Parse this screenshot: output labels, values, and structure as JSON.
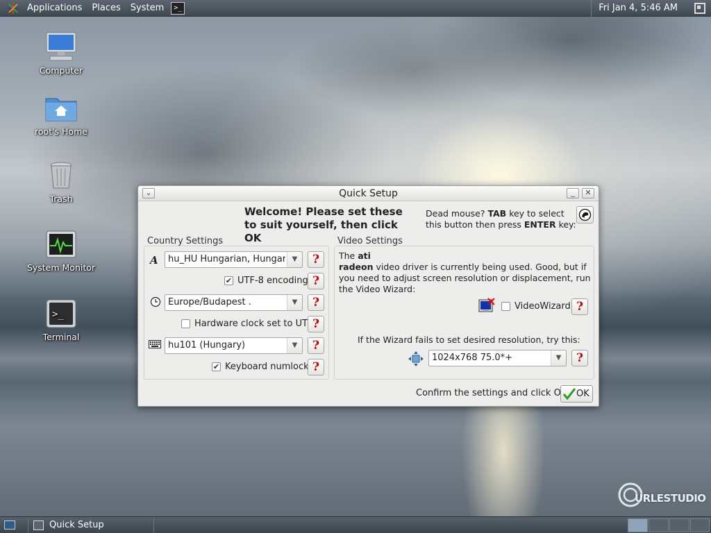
{
  "top_panel": {
    "menus": [
      "Applications",
      "Places",
      "System"
    ],
    "clock": "Fri Jan  4,  5:46 AM",
    "terminal_glyph": ">_"
  },
  "desktop": {
    "icons": [
      {
        "label": "Computer"
      },
      {
        "label": "root's Home"
      },
      {
        "label": "Trash"
      },
      {
        "label": "System Monitor"
      },
      {
        "label": "Terminal",
        "glyph": ">_"
      }
    ]
  },
  "dialog": {
    "title": "Quick Setup",
    "minimize_glyph": "_",
    "close_glyph": "✕",
    "menu_glyph": "⌄",
    "welcome": "Welcome! Please set these to suit yourself, then click OK",
    "dead_mouse": {
      "part1": "Dead mouse? ",
      "key1": "TAB",
      "part2": " key to select this button then press ",
      "key2": "ENTER",
      "part3": " key:"
    },
    "country": {
      "title": "Country Settings",
      "language_value": "hu_HU       Hungarian, Hungary",
      "utf8_label": "UTF-8 encoding",
      "utf8_checked": true,
      "timezone_value": "Europe/Budapest     .",
      "hwclock_label": "Hardware clock set to UTC",
      "hwclock_checked": false,
      "keyboard_value": "hu101        (Hungary)",
      "numlock_label": "Keyboard numlock",
      "numlock_checked": true
    },
    "video": {
      "title": "Video Settings",
      "text_the": "The ",
      "driver1": "ati",
      "driver2": "radeon",
      "text_rest": " video driver is currently being used. Good, but if you need to adjust screen resolution or displacement, run the Video Wizard:",
      "wizard_label": "VideoWizard",
      "wizard_checked": false,
      "fallback_text": "If the Wizard fails to set desired resolution, try this:",
      "resolution_value": "1024x768   75.0*+"
    },
    "confirm_text": "Confirm the settings and click OK:",
    "ok_label": "OK",
    "help_glyph": "?",
    "combo_arrow": "▼",
    "check_glyph": "✔"
  },
  "taskbar": {
    "task_label": "Quick Setup"
  },
  "branding": "URLESTUDIO",
  "colors": {
    "help_red": "#d00000",
    "ok_green": "#2e9a1c",
    "panel": "#4a545d"
  }
}
